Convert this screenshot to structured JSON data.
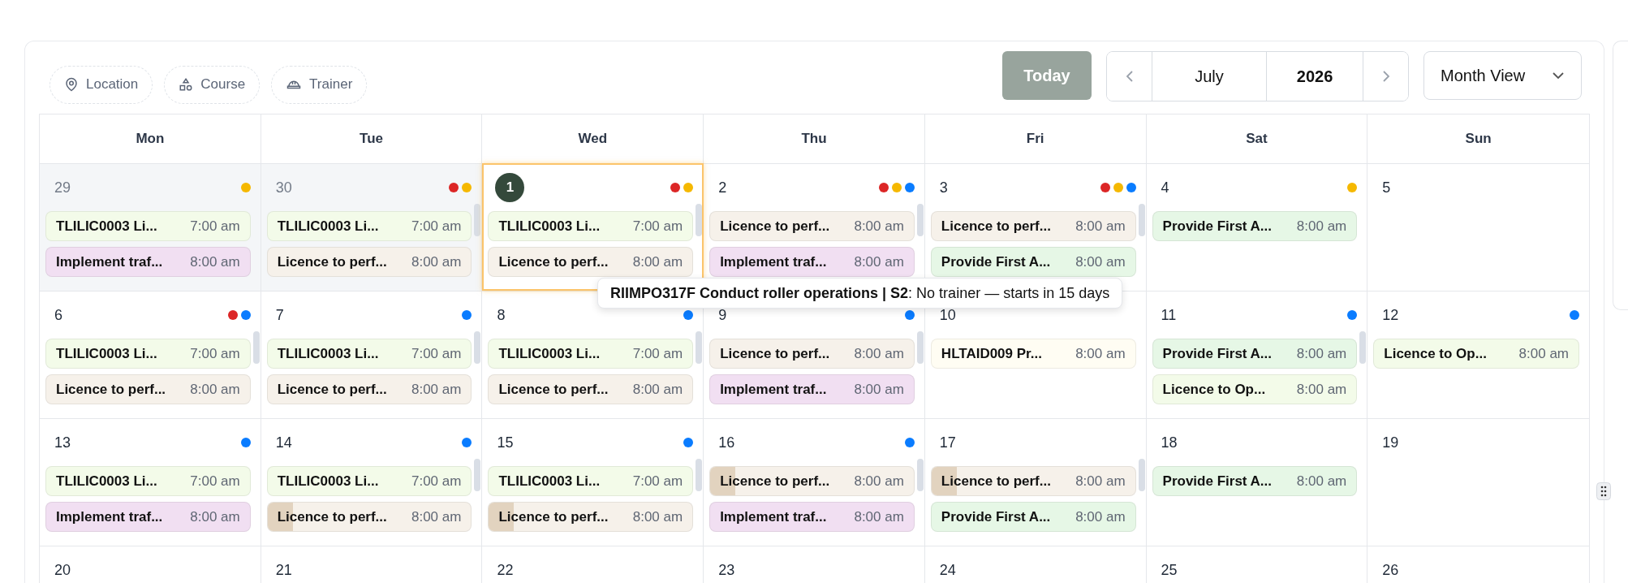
{
  "filters": [
    {
      "kind": "location",
      "label": "Location"
    },
    {
      "kind": "course",
      "label": "Course"
    },
    {
      "kind": "trainer",
      "label": "Trainer"
    }
  ],
  "toolbar": {
    "today": "Today",
    "month": "July",
    "year": "2026",
    "view": "Month View"
  },
  "weekdays": [
    "Mon",
    "Tue",
    "Wed",
    "Thu",
    "Fri",
    "Sat",
    "Sun"
  ],
  "weeks": [
    {
      "days": [
        {
          "number": "29",
          "outside_month": true,
          "today": false,
          "scrollable": false,
          "dots": [
            {
              "color": "#f5b800"
            }
          ],
          "events": [
            {
              "title": "TLILIC0003 Li...",
              "time": "7:00 am",
              "color": "#f3fbe9",
              "marked": false
            },
            {
              "title": "Implement traf...",
              "time": "8:00 am",
              "color": "#f1dff2",
              "marked": false
            }
          ]
        },
        {
          "number": "30",
          "outside_month": true,
          "today": false,
          "scrollable": true,
          "dots": [
            {
              "color": "#dc2626"
            },
            {
              "color": "#f5b800"
            }
          ],
          "events": [
            {
              "title": "TLILIC0003 Li...",
              "time": "7:00 am",
              "color": "#f3fbe9",
              "marked": false
            },
            {
              "title": "Licence to perf...",
              "time": "8:00 am",
              "color": "#f6f1ea",
              "marked": false
            }
          ]
        },
        {
          "number": "1",
          "outside_month": false,
          "today": true,
          "scrollable": true,
          "dots": [
            {
              "color": "#dc2626"
            },
            {
              "color": "#f5b800"
            }
          ],
          "events": [
            {
              "title": "TLILIC0003 Li...",
              "time": "7:00 am",
              "color": "#f3fbe9",
              "marked": false
            },
            {
              "title": "Licence to perf...",
              "time": "8:00 am",
              "color": "#f6f1ea",
              "marked": false
            }
          ]
        },
        {
          "number": "2",
          "outside_month": false,
          "today": false,
          "scrollable": true,
          "dots": [
            {
              "color": "#dc2626"
            },
            {
              "color": "#f5b800"
            },
            {
              "color": "#0a7cff"
            }
          ],
          "events": [
            {
              "title": "Licence to perf...",
              "time": "8:00 am",
              "color": "#f6f1ea",
              "marked": false
            },
            {
              "title": "Implement traf...",
              "time": "8:00 am",
              "color": "#f1dff2",
              "marked": false
            }
          ]
        },
        {
          "number": "3",
          "outside_month": false,
          "today": false,
          "scrollable": true,
          "dots": [
            {
              "color": "#dc2626"
            },
            {
              "color": "#f5b800"
            },
            {
              "color": "#0a7cff"
            }
          ],
          "events": [
            {
              "title": "Licence to perf...",
              "time": "8:00 am",
              "color": "#f6f1ea",
              "marked": false
            },
            {
              "title": "Provide First A...",
              "time": "8:00 am",
              "color": "#e6f7e6",
              "marked": false
            }
          ]
        },
        {
          "number": "4",
          "outside_month": false,
          "today": false,
          "scrollable": false,
          "dots": [
            {
              "color": "#f5b800"
            }
          ],
          "events": [
            {
              "title": "Provide First A...",
              "time": "8:00 am",
              "color": "#e6f7e6",
              "marked": false
            }
          ]
        },
        {
          "number": "5",
          "outside_month": false,
          "today": false,
          "scrollable": false
        }
      ]
    },
    {
      "days": [
        {
          "number": "6",
          "outside_month": false,
          "today": false,
          "scrollable": true,
          "dots": [
            {
              "color": "#dc2626"
            },
            {
              "color": "#0a7cff"
            }
          ],
          "events": [
            {
              "title": "TLILIC0003 Li...",
              "time": "7:00 am",
              "color": "#f3fbe9",
              "marked": false
            },
            {
              "title": "Licence to perf...",
              "time": "8:00 am",
              "color": "#f6f1ea",
              "marked": false
            }
          ]
        },
        {
          "number": "7",
          "outside_month": false,
          "today": false,
          "scrollable": true,
          "dots": [
            {
              "color": "#0a7cff"
            }
          ],
          "events": [
            {
              "title": "TLILIC0003 Li...",
              "time": "7:00 am",
              "color": "#f3fbe9",
              "marked": false
            },
            {
              "title": "Licence to perf...",
              "time": "8:00 am",
              "color": "#f6f1ea",
              "marked": false
            }
          ]
        },
        {
          "number": "8",
          "outside_month": false,
          "today": false,
          "scrollable": true,
          "dots": [
            {
              "color": "#0a7cff"
            }
          ],
          "events": [
            {
              "title": "TLILIC0003 Li...",
              "time": "7:00 am",
              "color": "#f3fbe9",
              "marked": false
            },
            {
              "title": "Licence to perf...",
              "time": "8:00 am",
              "color": "#f6f1ea",
              "marked": false
            }
          ]
        },
        {
          "number": "9",
          "outside_month": false,
          "today": false,
          "scrollable": true,
          "dots": [
            {
              "color": "#0a7cff"
            }
          ],
          "events": [
            {
              "title": "Licence to perf...",
              "time": "8:00 am",
              "color": "#f6f1ea",
              "marked": false
            },
            {
              "title": "Implement traf...",
              "time": "8:00 am",
              "color": "#f1dff2",
              "marked": false
            }
          ]
        },
        {
          "number": "10",
          "outside_month": false,
          "today": false,
          "scrollable": false,
          "events": [
            {
              "title": "HLTAID009 Pr...",
              "time": "8:00 am",
              "color": "#fffdf3",
              "marked": false
            }
          ]
        },
        {
          "number": "11",
          "outside_month": false,
          "today": false,
          "scrollable": true,
          "dots": [
            {
              "color": "#0a7cff"
            }
          ],
          "events": [
            {
              "title": "Provide First A...",
              "time": "8:00 am",
              "color": "#e6f7e6",
              "marked": false
            },
            {
              "title": "Licence to Op...",
              "time": "8:00 am",
              "color": "#f3fbe9",
              "marked": false
            }
          ]
        },
        {
          "number": "12",
          "outside_month": false,
          "today": false,
          "scrollable": false,
          "dots": [
            {
              "color": "#0a7cff"
            }
          ],
          "events": [
            {
              "title": "Licence to Op...",
              "time": "8:00 am",
              "color": "#f3fbe9",
              "marked": false
            }
          ]
        }
      ]
    },
    {
      "days": [
        {
          "number": "13",
          "outside_month": false,
          "today": false,
          "scrollable": false,
          "dots": [
            {
              "color": "#0a7cff"
            }
          ],
          "events": [
            {
              "title": "TLILIC0003 Li...",
              "time": "7:00 am",
              "color": "#f3fbe9",
              "marked": false
            },
            {
              "title": "Implement traf...",
              "time": "8:00 am",
              "color": "#f1dff2",
              "marked": false
            }
          ]
        },
        {
          "number": "14",
          "outside_month": false,
          "today": false,
          "scrollable": true,
          "dots": [
            {
              "color": "#0a7cff"
            }
          ],
          "events": [
            {
              "title": "TLILIC0003 Li...",
              "time": "7:00 am",
              "color": "#f3fbe9",
              "marked": false
            },
            {
              "title": "Licence to perf...",
              "time": "8:00 am",
              "color": "#f6f1ea",
              "marked": true
            }
          ]
        },
        {
          "number": "15",
          "outside_month": false,
          "today": false,
          "scrollable": true,
          "dots": [
            {
              "color": "#0a7cff"
            }
          ],
          "events": [
            {
              "title": "TLILIC0003 Li...",
              "time": "7:00 am",
              "color": "#f3fbe9",
              "marked": false
            },
            {
              "title": "Licence to perf...",
              "time": "8:00 am",
              "color": "#f6f1ea",
              "marked": true
            }
          ]
        },
        {
          "number": "16",
          "outside_month": false,
          "today": false,
          "scrollable": true,
          "dots": [
            {
              "color": "#0a7cff"
            }
          ],
          "events": [
            {
              "title": "Licence to perf...",
              "time": "8:00 am",
              "color": "#f6f1ea",
              "marked": true
            },
            {
              "title": "Implement traf...",
              "time": "8:00 am",
              "color": "#f1dff2",
              "marked": false
            }
          ]
        },
        {
          "number": "17",
          "outside_month": false,
          "today": false,
          "scrollable": true,
          "events": [
            {
              "title": "Licence to perf...",
              "time": "8:00 am",
              "color": "#f6f1ea",
              "marked": true
            },
            {
              "title": "Provide First A...",
              "time": "8:00 am",
              "color": "#e6f7e6",
              "marked": false
            }
          ]
        },
        {
          "number": "18",
          "outside_month": false,
          "today": false,
          "scrollable": false,
          "events": [
            {
              "title": "Provide First A...",
              "time": "8:00 am",
              "color": "#e6f7e6",
              "marked": false
            }
          ]
        },
        {
          "number": "19",
          "outside_month": false,
          "today": false,
          "scrollable": false
        }
      ]
    },
    {
      "days": [
        {
          "number": "20",
          "outside_month": false,
          "today": false,
          "scrollable": false
        },
        {
          "number": "21",
          "outside_month": false,
          "today": false,
          "scrollable": false
        },
        {
          "number": "22",
          "outside_month": false,
          "today": false,
          "scrollable": false
        },
        {
          "number": "23",
          "outside_month": false,
          "today": false,
          "scrollable": false
        },
        {
          "number": "24",
          "outside_month": false,
          "today": false,
          "scrollable": false
        },
        {
          "number": "25",
          "outside_month": false,
          "today": false,
          "scrollable": false
        },
        {
          "number": "26",
          "outside_month": false,
          "today": false,
          "scrollable": false
        }
      ]
    }
  ],
  "tooltip": {
    "text": "**RIIMPO317F Conduct roller operations | S2**: No trainer — starts in 15 days"
  }
}
